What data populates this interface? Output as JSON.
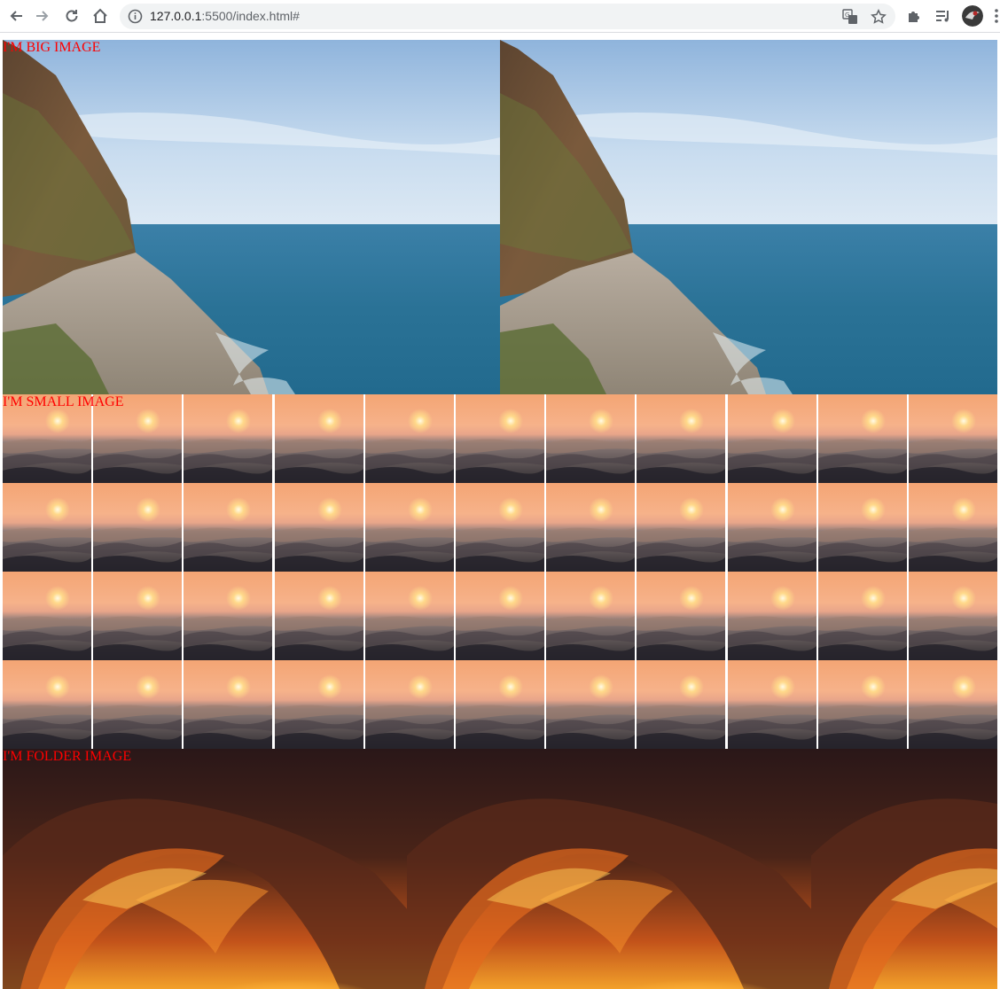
{
  "browser": {
    "url_host": "127.0.0.1",
    "url_rest": ":5500/index.html#",
    "icons": {
      "back": "arrow-left-icon",
      "forward": "arrow-right-icon",
      "reload": "reload-icon",
      "home": "home-icon",
      "site_info": "info-icon",
      "translate": "translate-icon",
      "bookmark": "star-icon",
      "extensions": "puzzle-icon",
      "media": "media-queue-icon",
      "menu": "kebab-icon"
    }
  },
  "sections": {
    "big": {
      "label": "I'M BIG IMAGE",
      "image": "coastal cliff and ocean"
    },
    "small": {
      "label": "I'M SMALL IMAGE",
      "image": "sunset over waves"
    },
    "folder": {
      "label": "I'M FOLDER IMAGE",
      "image": "fiery wave barrel at sunset"
    }
  },
  "colors": {
    "label": "#ff0000",
    "omnibox_bg": "#f1f3f4"
  }
}
